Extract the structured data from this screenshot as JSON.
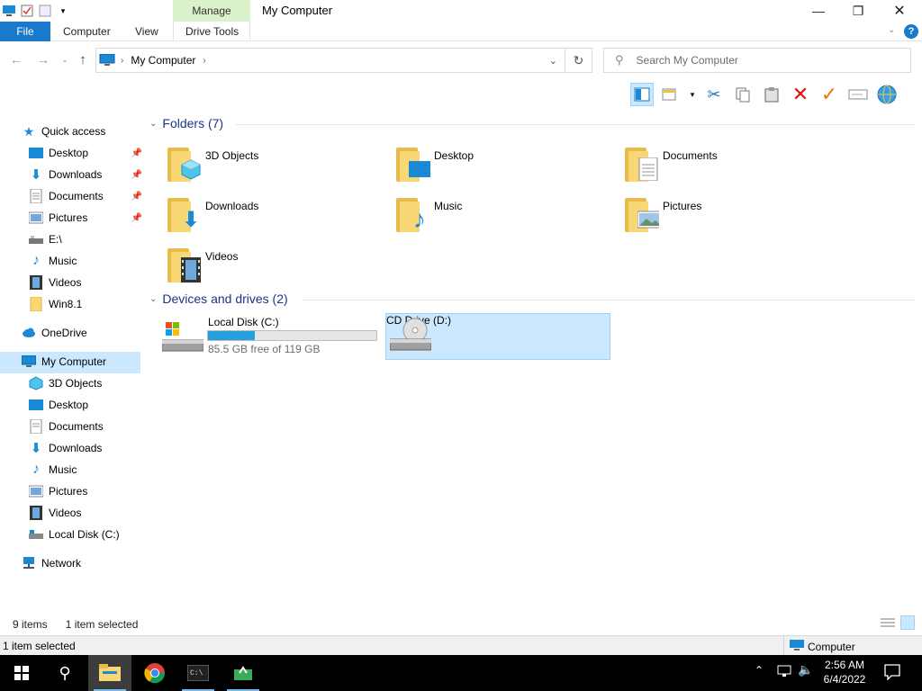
{
  "window": {
    "title": "My Computer",
    "context_tab": "Manage",
    "context_subtab": "Drive Tools"
  },
  "ribbon": {
    "file": "File",
    "tabs": [
      "Computer",
      "View"
    ]
  },
  "address": {
    "path": "My Computer",
    "search_placeholder": "Search My Computer"
  },
  "nav": {
    "quick_access": "Quick access",
    "quick_items": [
      "Desktop",
      "Downloads",
      "Documents",
      "Pictures",
      "E:\\",
      "Music",
      "Videos",
      "Win8.1"
    ],
    "onedrive": "OneDrive",
    "my_computer": "My Computer",
    "pc_items": [
      "3D Objects",
      "Desktop",
      "Documents",
      "Downloads",
      "Music",
      "Pictures",
      "Videos",
      "Local Disk (C:)"
    ],
    "network": "Network"
  },
  "folders": {
    "header": "Folders (7)",
    "items": [
      "3D Objects",
      "Desktop",
      "Documents",
      "Downloads",
      "Music",
      "Pictures",
      "Videos"
    ]
  },
  "drives": {
    "header": "Devices and drives (2)",
    "c_name": "Local Disk (C:)",
    "c_free": "85.5 GB free of 119 GB",
    "c_used_fraction": 0.28,
    "d_name": "CD Drive (D:)"
  },
  "status": {
    "count": "9 items",
    "selected": "1 item selected",
    "bottom_left": "1 item selected",
    "bottom_right": "Computer"
  },
  "clock": {
    "time": "2:56 AM",
    "date": "6/4/2022"
  },
  "colors": {
    "accent": "#1979ca",
    "selection": "#cce8ff",
    "group_header": "#1e3287",
    "progress": "#26a0da"
  }
}
